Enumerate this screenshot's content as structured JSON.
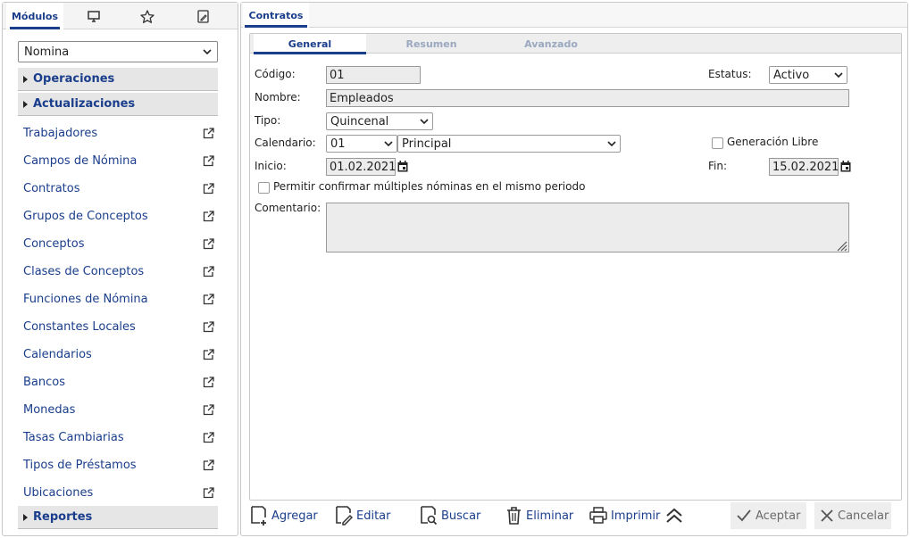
{
  "left_panel": {
    "tabs": [
      {
        "label": "Módulos",
        "icon": "modules"
      },
      {
        "label": "",
        "icon": "monitor-icon"
      },
      {
        "label": "",
        "icon": "star-icon"
      },
      {
        "label": "",
        "icon": "edit-document-icon"
      }
    ],
    "module_select": {
      "value": "Nomina"
    },
    "groups": {
      "operaciones": "Operaciones",
      "actualizaciones": "Actualizaciones",
      "reportes": "Reportes"
    },
    "items": [
      "Trabajadores",
      "Campos de Nómina",
      "Contratos",
      "Grupos de Conceptos",
      "Conceptos",
      "Clases de Conceptos",
      "Funciones de Nómina",
      "Constantes Locales",
      "Calendarios",
      "Bancos",
      "Monedas",
      "Tasas Cambiarias",
      "Tipos de Préstamos",
      "Ubicaciones"
    ]
  },
  "main": {
    "tab_title": "Contratos",
    "subtabs": [
      "General",
      "Resumen",
      "Avanzado"
    ],
    "form": {
      "codigo_label": "Código:",
      "codigo_value": "01",
      "estatus_label": "Estatus:",
      "estatus_value": "Activo",
      "nombre_label": "Nombre:",
      "nombre_value": "Empleados",
      "tipo_label": "Tipo:",
      "tipo_value": "Quincenal",
      "calendario_label": "Calendario:",
      "calendario_code": "01",
      "calendario_name": "Principal",
      "generacion_libre_label": "Generación Libre",
      "inicio_label": "Inicio:",
      "inicio_value": "01.02.2021",
      "fin_label": "Fin:",
      "fin_value": "15.02.2021",
      "permitir_label": "Permitir confirmar múltiples nóminas en el mismo periodo",
      "comentario_label": "Comentario:",
      "comentario_value": ""
    },
    "toolbar": {
      "agregar": "Agregar",
      "editar": "Editar",
      "buscar": "Buscar",
      "eliminar": "Eliminar",
      "imprimir": "Imprimir",
      "aceptar": "Aceptar",
      "cancelar": "Cancelar"
    }
  },
  "colors": {
    "accent": "#1a3e8c",
    "group_bg": "#e6e6e6",
    "field_bg": "#ececec",
    "disabled_text": "#6b6b6b"
  }
}
